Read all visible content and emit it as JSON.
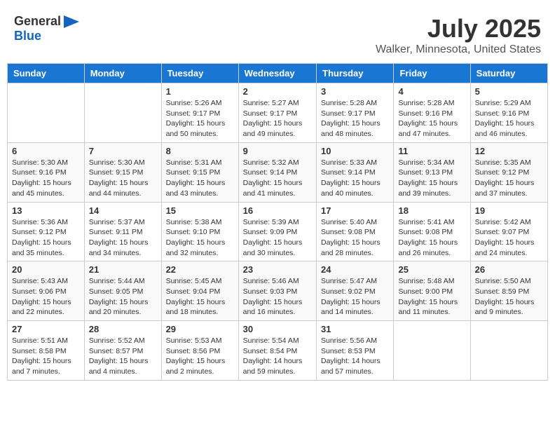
{
  "header": {
    "logo_general": "General",
    "logo_blue": "Blue",
    "title": "July 2025",
    "location": "Walker, Minnesota, United States"
  },
  "days_of_week": [
    "Sunday",
    "Monday",
    "Tuesday",
    "Wednesday",
    "Thursday",
    "Friday",
    "Saturday"
  ],
  "weeks": [
    [
      {
        "day": "",
        "details": ""
      },
      {
        "day": "",
        "details": ""
      },
      {
        "day": "1",
        "details": "Sunrise: 5:26 AM\nSunset: 9:17 PM\nDaylight: 15 hours and 50 minutes."
      },
      {
        "day": "2",
        "details": "Sunrise: 5:27 AM\nSunset: 9:17 PM\nDaylight: 15 hours and 49 minutes."
      },
      {
        "day": "3",
        "details": "Sunrise: 5:28 AM\nSunset: 9:17 PM\nDaylight: 15 hours and 48 minutes."
      },
      {
        "day": "4",
        "details": "Sunrise: 5:28 AM\nSunset: 9:16 PM\nDaylight: 15 hours and 47 minutes."
      },
      {
        "day": "5",
        "details": "Sunrise: 5:29 AM\nSunset: 9:16 PM\nDaylight: 15 hours and 46 minutes."
      }
    ],
    [
      {
        "day": "6",
        "details": "Sunrise: 5:30 AM\nSunset: 9:16 PM\nDaylight: 15 hours and 45 minutes."
      },
      {
        "day": "7",
        "details": "Sunrise: 5:30 AM\nSunset: 9:15 PM\nDaylight: 15 hours and 44 minutes."
      },
      {
        "day": "8",
        "details": "Sunrise: 5:31 AM\nSunset: 9:15 PM\nDaylight: 15 hours and 43 minutes."
      },
      {
        "day": "9",
        "details": "Sunrise: 5:32 AM\nSunset: 9:14 PM\nDaylight: 15 hours and 41 minutes."
      },
      {
        "day": "10",
        "details": "Sunrise: 5:33 AM\nSunset: 9:14 PM\nDaylight: 15 hours and 40 minutes."
      },
      {
        "day": "11",
        "details": "Sunrise: 5:34 AM\nSunset: 9:13 PM\nDaylight: 15 hours and 39 minutes."
      },
      {
        "day": "12",
        "details": "Sunrise: 5:35 AM\nSunset: 9:12 PM\nDaylight: 15 hours and 37 minutes."
      }
    ],
    [
      {
        "day": "13",
        "details": "Sunrise: 5:36 AM\nSunset: 9:12 PM\nDaylight: 15 hours and 35 minutes."
      },
      {
        "day": "14",
        "details": "Sunrise: 5:37 AM\nSunset: 9:11 PM\nDaylight: 15 hours and 34 minutes."
      },
      {
        "day": "15",
        "details": "Sunrise: 5:38 AM\nSunset: 9:10 PM\nDaylight: 15 hours and 32 minutes."
      },
      {
        "day": "16",
        "details": "Sunrise: 5:39 AM\nSunset: 9:09 PM\nDaylight: 15 hours and 30 minutes."
      },
      {
        "day": "17",
        "details": "Sunrise: 5:40 AM\nSunset: 9:08 PM\nDaylight: 15 hours and 28 minutes."
      },
      {
        "day": "18",
        "details": "Sunrise: 5:41 AM\nSunset: 9:08 PM\nDaylight: 15 hours and 26 minutes."
      },
      {
        "day": "19",
        "details": "Sunrise: 5:42 AM\nSunset: 9:07 PM\nDaylight: 15 hours and 24 minutes."
      }
    ],
    [
      {
        "day": "20",
        "details": "Sunrise: 5:43 AM\nSunset: 9:06 PM\nDaylight: 15 hours and 22 minutes."
      },
      {
        "day": "21",
        "details": "Sunrise: 5:44 AM\nSunset: 9:05 PM\nDaylight: 15 hours and 20 minutes."
      },
      {
        "day": "22",
        "details": "Sunrise: 5:45 AM\nSunset: 9:04 PM\nDaylight: 15 hours and 18 minutes."
      },
      {
        "day": "23",
        "details": "Sunrise: 5:46 AM\nSunset: 9:03 PM\nDaylight: 15 hours and 16 minutes."
      },
      {
        "day": "24",
        "details": "Sunrise: 5:47 AM\nSunset: 9:02 PM\nDaylight: 15 hours and 14 minutes."
      },
      {
        "day": "25",
        "details": "Sunrise: 5:48 AM\nSunset: 9:00 PM\nDaylight: 15 hours and 11 minutes."
      },
      {
        "day": "26",
        "details": "Sunrise: 5:50 AM\nSunset: 8:59 PM\nDaylight: 15 hours and 9 minutes."
      }
    ],
    [
      {
        "day": "27",
        "details": "Sunrise: 5:51 AM\nSunset: 8:58 PM\nDaylight: 15 hours and 7 minutes."
      },
      {
        "day": "28",
        "details": "Sunrise: 5:52 AM\nSunset: 8:57 PM\nDaylight: 15 hours and 4 minutes."
      },
      {
        "day": "29",
        "details": "Sunrise: 5:53 AM\nSunset: 8:56 PM\nDaylight: 15 hours and 2 minutes."
      },
      {
        "day": "30",
        "details": "Sunrise: 5:54 AM\nSunset: 8:54 PM\nDaylight: 14 hours and 59 minutes."
      },
      {
        "day": "31",
        "details": "Sunrise: 5:56 AM\nSunset: 8:53 PM\nDaylight: 14 hours and 57 minutes."
      },
      {
        "day": "",
        "details": ""
      },
      {
        "day": "",
        "details": ""
      }
    ]
  ]
}
